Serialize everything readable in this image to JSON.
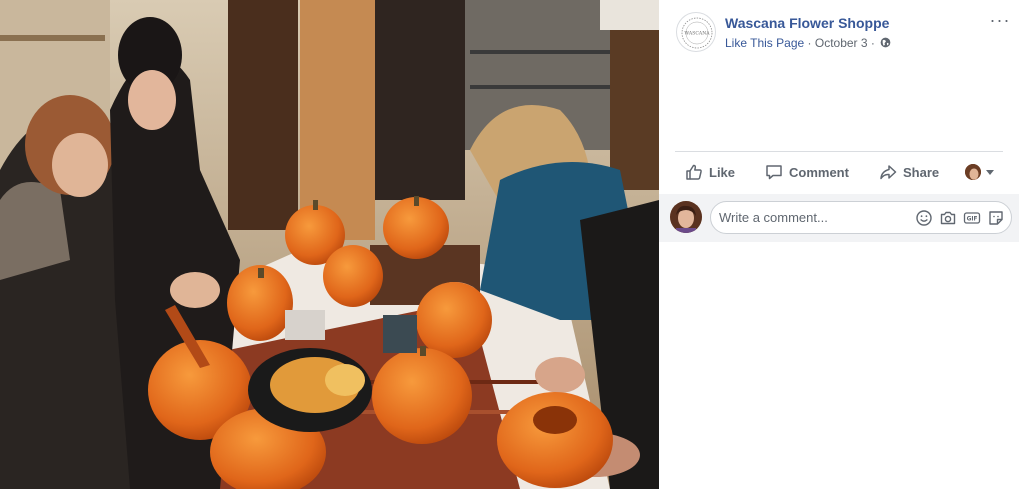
{
  "post": {
    "page_name": "Wascana Flower Shoppe",
    "like_page_label": "Like This Page",
    "separator": "·",
    "date": "October 3",
    "avatar_text": "WASCANA",
    "more_label": "···"
  },
  "actions": {
    "like_label": "Like",
    "comment_label": "Comment",
    "share_label": "Share"
  },
  "comment": {
    "placeholder": "Write a comment..."
  },
  "tools": {
    "gif_label": "GIF"
  },
  "colors": {
    "link": "#385898",
    "muted": "#606770",
    "divider": "#dadde1",
    "comment_bg": "#f2f3f5"
  }
}
